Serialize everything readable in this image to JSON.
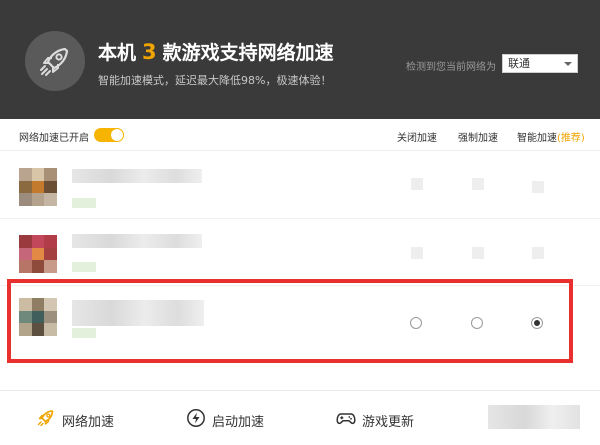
{
  "header": {
    "title_prefix": "本机",
    "count": "3",
    "title_suffix": "款游戏支持网络加速",
    "subtitle": "智能加速模式，延迟最大降低98%，极速体验！",
    "network_label": "检测到您当前网络为",
    "network_value": "联通"
  },
  "toolbar": {
    "toggle_label": "网络加速已开启",
    "toggle_on": true,
    "col_off": "关闭加速",
    "col_force": "强制加速",
    "col_smart": "智能加速",
    "col_smart_note": "(推荐)"
  },
  "games": [
    {
      "selected": null
    },
    {
      "selected": null
    },
    {
      "selected": "smart"
    }
  ],
  "bottom_nav": {
    "items": [
      {
        "label": "网络加速",
        "icon": "rocket-icon",
        "active": true
      },
      {
        "label": "启动加速",
        "icon": "lightning-icon",
        "active": false
      },
      {
        "label": "游戏更新",
        "icon": "gamepad-icon",
        "active": false
      }
    ]
  },
  "colors": {
    "accent": "#f0a400",
    "header_bg": "#3a3a3a",
    "highlight": "#e8312e"
  }
}
